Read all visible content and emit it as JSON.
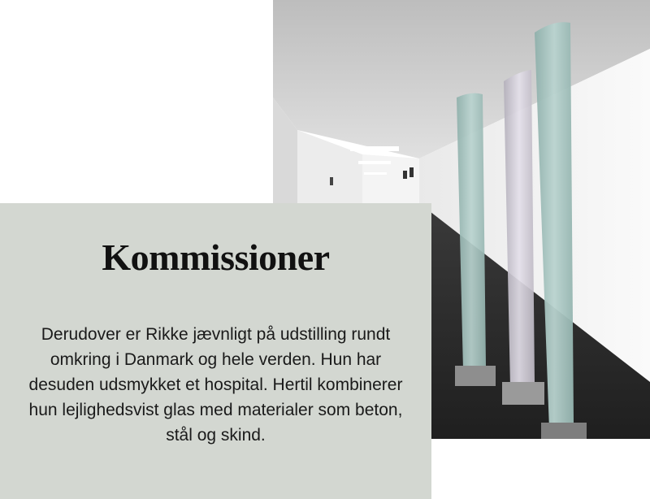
{
  "section": {
    "title": "Kommissioner",
    "body": "Derudover er Rikke jævnligt på udstilling rundt omkring i Danmark og hele verden. Hun har desuden udsmykket et hospital. Hertil kombinerer hun lejlighedsvist glas med materialer som beton, stål og skind."
  },
  "photo": {
    "subject": "hospital-corridor-glass-sculptures",
    "colors": {
      "glass": "#a9c3bf",
      "wall": "#f2f2f2",
      "floor": "#2b2b2b",
      "ceiling": "#c9c9c9"
    }
  },
  "colors": {
    "card_background": "#d3d7d1",
    "text": "#111111"
  }
}
